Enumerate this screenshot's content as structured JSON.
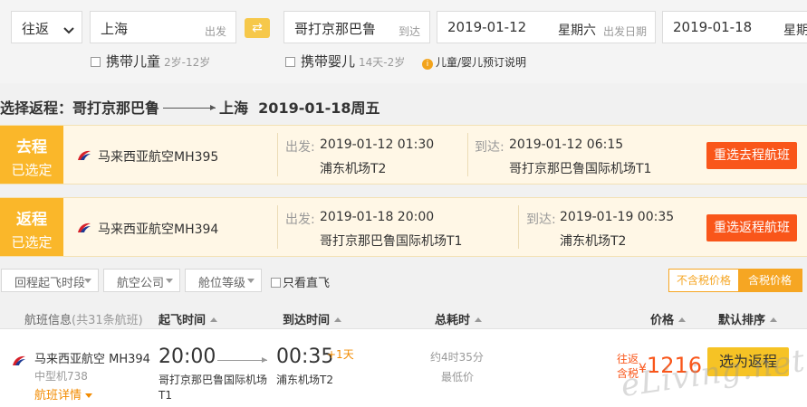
{
  "search": {
    "trip_type": "往返",
    "from_city": "上海",
    "from_hint": "出发",
    "to_city": "哥打京那巴鲁",
    "to_hint": "到达",
    "depart_date": "2019-01-12",
    "depart_weekday": "星期六",
    "depart_hint": "出发日期",
    "return_date": "2019-01-18",
    "return_weekday": "星期",
    "child_label": "携带儿童",
    "child_age": "2岁-12岁",
    "infant_label": "携带婴儿",
    "infant_age": "14天-2岁",
    "booking_note": "儿童/婴儿预订说明"
  },
  "route": {
    "prefix": "选择返程：哥打京那巴鲁",
    "dest": "上海",
    "date": "2019-01-18周五"
  },
  "segments": [
    {
      "tag": "去程",
      "status": "已选定",
      "airline": "马来西亚航空MH395",
      "depart_label": "出发:",
      "depart_time": "2019-01-12 01:30",
      "depart_airport": "浦东机场T2",
      "arrive_label": "到达:",
      "arrive_time": "2019-01-12 06:15",
      "arrive_airport": "哥打京那巴鲁国际机场T1",
      "button": "重选去程航班"
    },
    {
      "tag": "返程",
      "status": "已选定",
      "airline": "马来西亚航空MH394",
      "depart_label": "出发:",
      "depart_time": "2019-01-18 20:00",
      "depart_airport": "哥打京那巴鲁国际机场T1",
      "arrive_label": "到达:",
      "arrive_time": "2019-01-19 00:35",
      "arrive_airport": "浦东机场T2",
      "button": "重选返程航班"
    }
  ],
  "filters": {
    "return_time": "回程起飞时段",
    "airline": "航空公司",
    "cabin": "舱位等级",
    "direct_only": "只看直飞",
    "price_excl_tax": "不含税价格",
    "price_incl_tax": "含税价格"
  },
  "table_header": {
    "info": "航班信息",
    "count": "(共31条航班)",
    "depart": "起飞时间",
    "arrive": "到达时间",
    "duration": "总耗时",
    "price": "价格",
    "sort": "默认排序"
  },
  "flight": {
    "name": "马来西亚航空 MH394",
    "plane": "中型机738",
    "detail": "航班详情",
    "depart_time": "20:00",
    "depart_airport": "哥打京那巴鲁国际机场",
    "depart_terminal": "T1",
    "arrive_time": "00:35",
    "plus_day": "+1天",
    "arrive_airport": "浦东机场T2",
    "duration": "约4时35分",
    "lowest": "最低价",
    "tag1": "往返",
    "tag2": "含税",
    "currency": "¥",
    "price": "1216",
    "select": "选为返程"
  },
  "watermark": "eLiving.net",
  "colors": {
    "accent": "#fab72a",
    "button_red": "#f9561a",
    "select_yellow": "#f6c325",
    "highlight_bg": "#fff7e6"
  }
}
